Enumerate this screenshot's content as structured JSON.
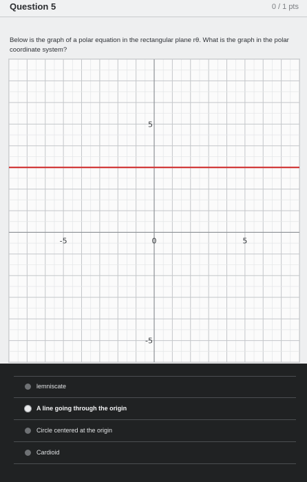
{
  "question": {
    "title": "Question 5",
    "points": "0 / 1 pts",
    "text": "Below is the graph of a polar equation in the rectangular plane rθ. What is the graph in the polar coordinate system?"
  },
  "chart_data": {
    "type": "line",
    "xlim": [
      -8,
      8
    ],
    "ylim": [
      -6,
      8
    ],
    "grid": true,
    "x_tick_labels": [
      "-5",
      "0",
      "5"
    ],
    "y_tick_labels": [
      "5",
      "-5"
    ],
    "series": [
      {
        "x": [
          -8,
          8
        ],
        "y": [
          3,
          3
        ],
        "color": "#d13a3a"
      }
    ]
  },
  "answers": {
    "options": [
      {
        "label": "lemniscate",
        "selected": false
      },
      {
        "label": "A line going through the origin",
        "selected": true
      },
      {
        "label": "Circle centered at the origin",
        "selected": false
      },
      {
        "label": "Cardioid",
        "selected": false
      }
    ]
  }
}
